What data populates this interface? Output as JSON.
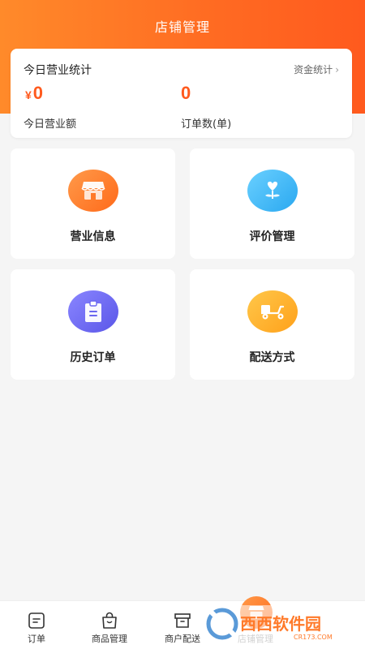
{
  "header": {
    "title": "店铺管理"
  },
  "stats": {
    "title": "今日营业统计",
    "link_label": "资金统计",
    "link_chevron": "›",
    "revenue": {
      "currency": "¥",
      "value": "0",
      "label": "今日营业额"
    },
    "orders": {
      "value": "0",
      "label": "订单数(单)"
    }
  },
  "tiles": [
    {
      "label": "营业信息",
      "icon": "storefront-icon"
    },
    {
      "label": "评价管理",
      "icon": "heart-plant-icon"
    },
    {
      "label": "历史订单",
      "icon": "clipboard-icon"
    },
    {
      "label": "配送方式",
      "icon": "scooter-icon"
    }
  ],
  "tabbar": {
    "items": [
      {
        "label": "订单",
        "icon": "order-icon"
      },
      {
        "label": "商品管理",
        "icon": "shopping-bag-icon"
      },
      {
        "label": "商户配送",
        "icon": "box-icon"
      },
      {
        "label": "店铺管理",
        "icon": "store-icon",
        "active": true
      }
    ]
  },
  "watermark": {
    "text": "西西软件园",
    "domain": "CR173.COM"
  },
  "colors": {
    "accent": "#ff6a22",
    "blue": "#2aa8f0",
    "purple": "#5a56e8",
    "yellow": "#ffa11a"
  }
}
